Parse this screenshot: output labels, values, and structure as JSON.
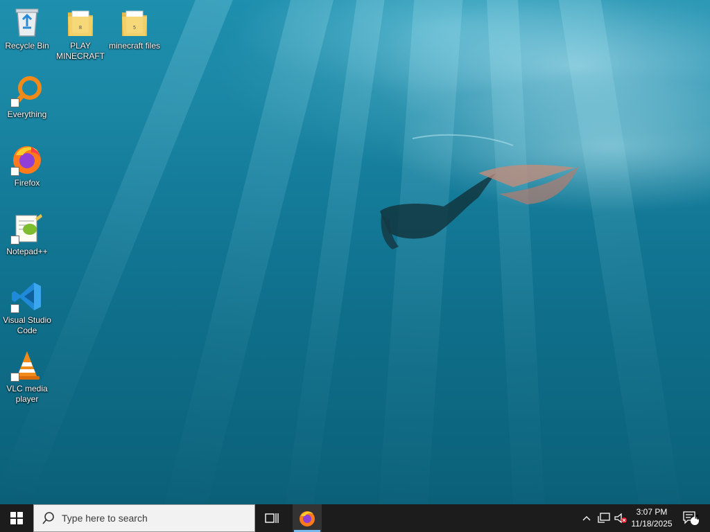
{
  "desktop": {
    "icons": [
      {
        "label": "Recycle Bin"
      },
      {
        "label": "PLAY MINECRAFT"
      },
      {
        "label": "minecraft files"
      },
      {
        "label": "Everything"
      },
      {
        "label": "Firefox"
      },
      {
        "label": "Notepad++"
      },
      {
        "label": "Visual Studio Code"
      },
      {
        "label": "VLC media player"
      }
    ],
    "folder_badges": [
      "8",
      "5"
    ]
  },
  "taskbar": {
    "search_placeholder": "Type here to search",
    "clock_time": "3:07 PM",
    "clock_date": "11/18/2025",
    "notification_count": "4",
    "pinned": [
      {
        "icon": "task-view-icon"
      },
      {
        "icon": "firefox-icon",
        "active": true
      }
    ],
    "tray_icons": [
      "chevron-up-icon",
      "network-icon",
      "volume-muted-icon"
    ]
  },
  "colors": {
    "taskbar_bg": "#1c1c1c",
    "active_indicator": "#76b9ed",
    "search_bg": "#f2f2f2"
  }
}
